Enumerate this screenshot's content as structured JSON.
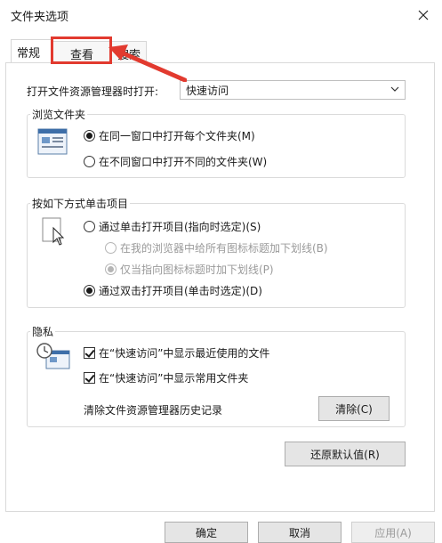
{
  "window": {
    "title": "文件夹选项",
    "close_icon": "close-icon"
  },
  "tabs": [
    {
      "label": "常规",
      "active": true
    },
    {
      "label": "查看",
      "active": false
    },
    {
      "label": "搜索",
      "active": false
    }
  ],
  "general": {
    "open_label": "打开文件资源管理器时打开:",
    "open_value": "快速访问",
    "browse": {
      "title": "浏览文件夹",
      "options": [
        {
          "label": "在同一窗口中打开每个文件夹(M)",
          "selected": true
        },
        {
          "label": "在不同窗口中打开不同的文件夹(W)",
          "selected": false
        }
      ]
    },
    "click": {
      "title": "按如下方式单击项目",
      "options": [
        {
          "label": "通过单击打开项目(指向时选定)(S)",
          "selected": false
        },
        {
          "label": "在我的浏览器中给所有图标标题加下划线(B)",
          "selected": false,
          "disabled": true
        },
        {
          "label": "仅当指向图标标题时加下划线(P)",
          "selected": true,
          "disabled": true
        },
        {
          "label": "通过双击打开项目(单击时选定)(D)",
          "selected": true
        }
      ]
    },
    "privacy": {
      "title": "隐私",
      "checks": [
        {
          "label": "在“快速访问”中显示最近使用的文件",
          "checked": true
        },
        {
          "label": "在“快速访问”中显示常用文件夹",
          "checked": true
        }
      ],
      "clear_label": "清除文件资源管理器历史记录",
      "clear_button": "清除(C)"
    },
    "restore_button": "还原默认值(R)"
  },
  "footer": {
    "ok": "确定",
    "cancel": "取消",
    "apply": "应用(A)"
  },
  "annotation": {
    "color": "#e23a2f"
  }
}
